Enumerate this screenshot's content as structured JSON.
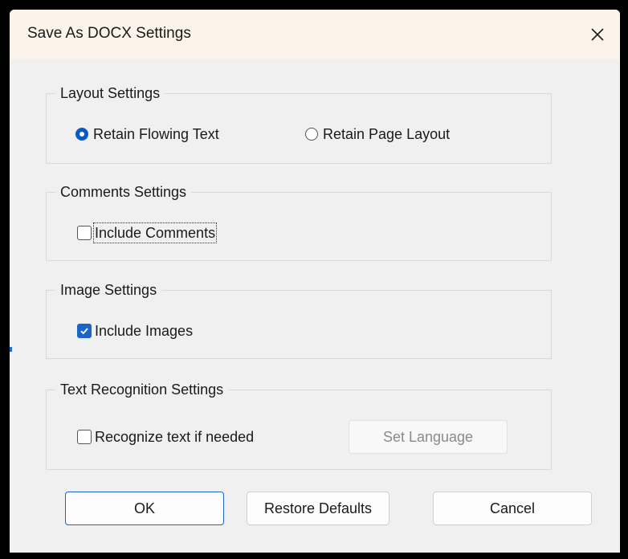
{
  "dialog": {
    "title": "Save As DOCX Settings",
    "close_icon": "close-icon"
  },
  "layout_settings": {
    "label": "Layout Settings",
    "options": [
      {
        "label": "Retain Flowing Text",
        "selected": true
      },
      {
        "label": "Retain Page Layout",
        "selected": false
      }
    ]
  },
  "comments_settings": {
    "label": "Comments Settings",
    "include_comments": {
      "label": "Include Comments",
      "checked": false
    }
  },
  "image_settings": {
    "label": "Image Settings",
    "include_images": {
      "label": "Include Images",
      "checked": true
    }
  },
  "text_recognition_settings": {
    "label": "Text Recognition Settings",
    "recognize_text": {
      "label": "Recognize text if needed",
      "checked": false
    },
    "set_language_label": "Set Language"
  },
  "buttons": {
    "ok_label": "OK",
    "restore_defaults_label": "Restore Defaults",
    "cancel_label": "Cancel"
  },
  "colors": {
    "accent": "#1a65c7",
    "titlebar": "#fcf4ea",
    "dialog_background": "#f0f0f0"
  }
}
